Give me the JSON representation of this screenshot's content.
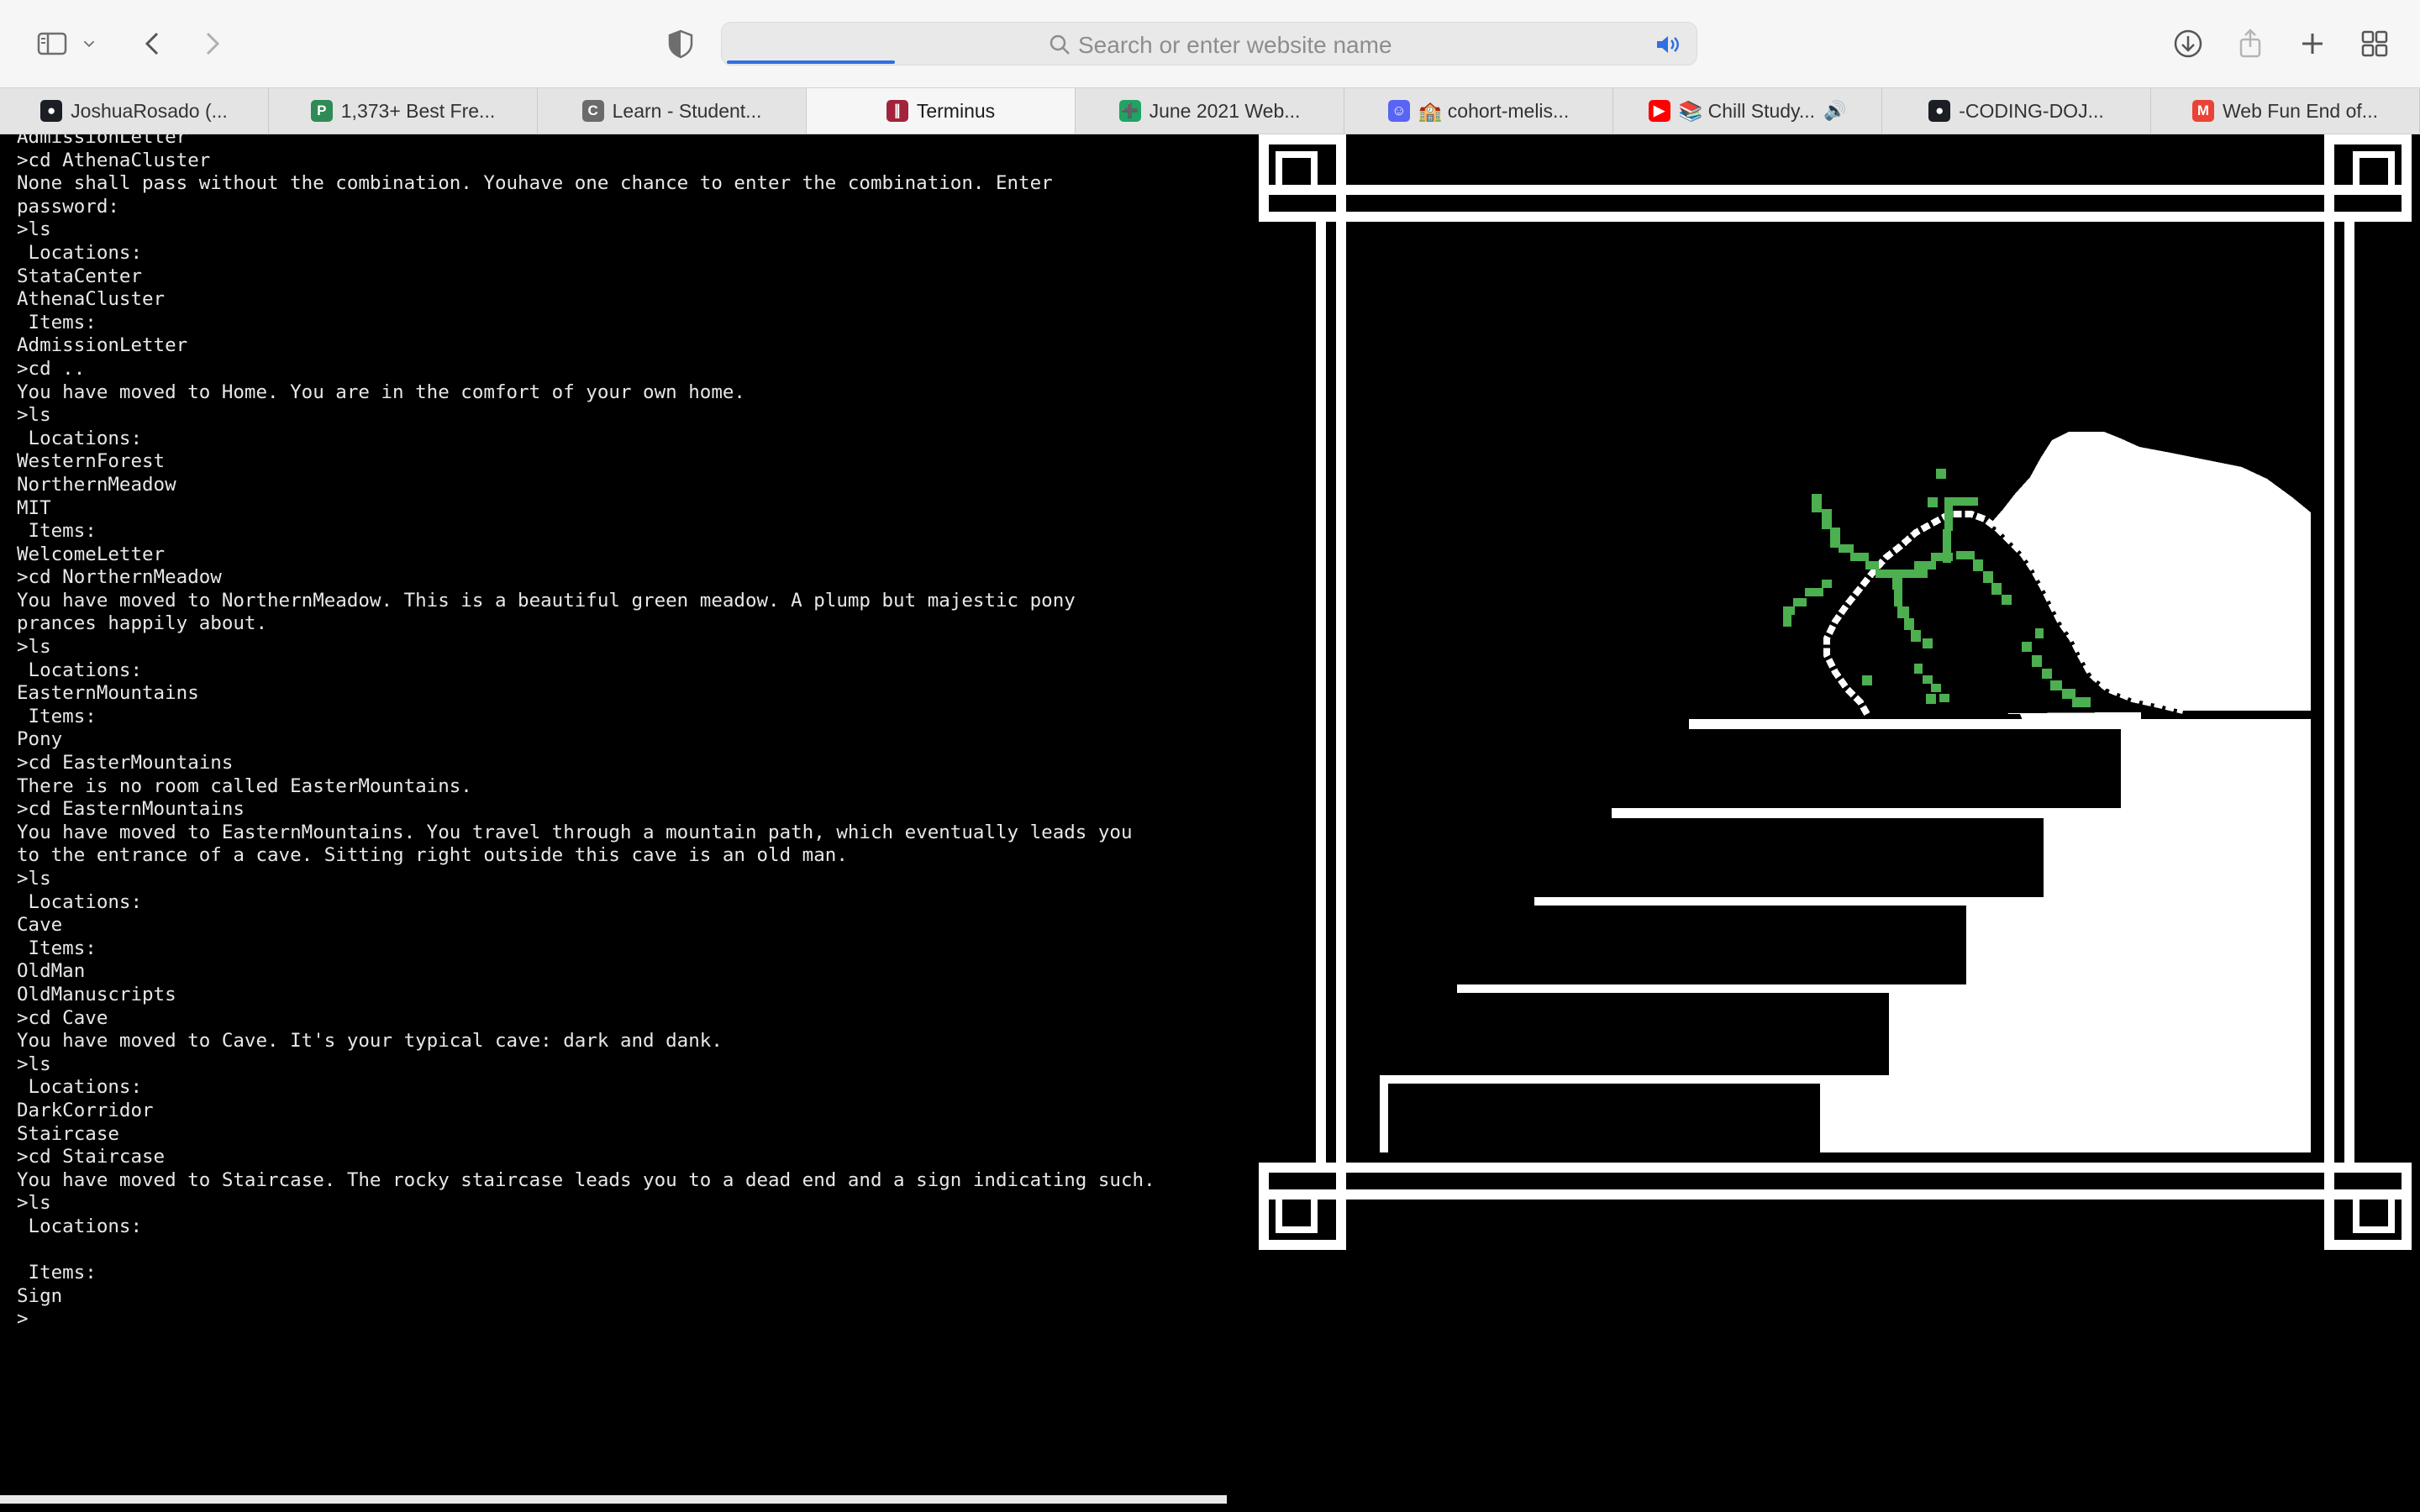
{
  "toolbar": {
    "search_placeholder": "Search or enter website name",
    "icons": [
      "sidebar-icon",
      "chevron-down-icon",
      "back-arrow-icon",
      "forward-arrow-icon",
      "shield-icon",
      "search-icon",
      "audio-icon",
      "download-icon",
      "share-icon",
      "plus-icon",
      "tab-overview-icon"
    ]
  },
  "tabs": [
    {
      "label": "JoshuaRosado (...",
      "icon": "github-icon",
      "color": "#1b1f23"
    },
    {
      "label": "1,373+ Best Fre...",
      "icon": "p-logo-icon",
      "color": "#2e8b57"
    },
    {
      "label": "Learn - Student...",
      "icon": "c-logo-icon",
      "color": "#6b6b6b"
    },
    {
      "label": "Terminus",
      "icon": "terminus-icon",
      "color": "#a1243b",
      "active": true
    },
    {
      "label": "June 2021 Web...",
      "icon": "sheets-icon",
      "color": "#1fa463"
    },
    {
      "label": "🏫 cohort-melis...",
      "icon": "discord-icon",
      "color": "#5865f2"
    },
    {
      "label": "📚 Chill Study...",
      "icon": "youtube-icon",
      "color": "#ff0000",
      "audio": "🔊"
    },
    {
      "label": "-CODING-DOJ...",
      "icon": "github-icon",
      "color": "#1b1f23"
    },
    {
      "label": "Web Fun End of...",
      "icon": "gmail-icon",
      "color": "#ea4335"
    }
  ],
  "terminal": {
    "lines": [
      "AdmissionLetter",
      ">cd AthenaCluster",
      "None shall pass without the combination. Youhave one chance to enter the combination. Enter",
      "password:",
      ">ls",
      " Locations:",
      "StataCenter",
      "AthenaCluster",
      " Items:",
      "AdmissionLetter",
      ">cd ..",
      "You have moved to Home. You are in the comfort of your own home.",
      ">ls",
      " Locations:",
      "WesternForest",
      "NorthernMeadow",
      "MIT",
      " Items:",
      "WelcomeLetter",
      ">cd NorthernMeadow",
      "You have moved to NorthernMeadow. This is a beautiful green meadow. A plump but majestic pony",
      "prances happily about.",
      ">ls",
      " Locations:",
      "EasternMountains",
      " Items:",
      "Pony",
      ">cd EasterMountains",
      "There is no room called EasterMountains.",
      ">cd EasternMountains",
      "You have moved to EasternMountains. You travel through a mountain path, which eventually leads you",
      "to the entrance of a cave. Sitting right outside this cave is an old man.",
      ">ls",
      " Locations:",
      "Cave",
      " Items:",
      "OldMan",
      "OldManuscripts",
      ">cd Cave",
      "You have moved to Cave. It's your typical cave: dark and dank.",
      ">ls",
      " Locations:",
      "DarkCorridor",
      "Staircase",
      ">cd Staircase",
      "You have moved to Staircase. The rocky staircase leads you to a dead end and a sign indicating such.",
      ">ls",
      " Locations:",
      "",
      " Items:",
      "Sign",
      ">"
    ]
  },
  "art": {
    "subject": "pixel-art staircase with cave rock and green moss in ornamental frame",
    "colors": {
      "background": "#000000",
      "lines": "#ffffff",
      "moss": "#4caf50"
    }
  }
}
